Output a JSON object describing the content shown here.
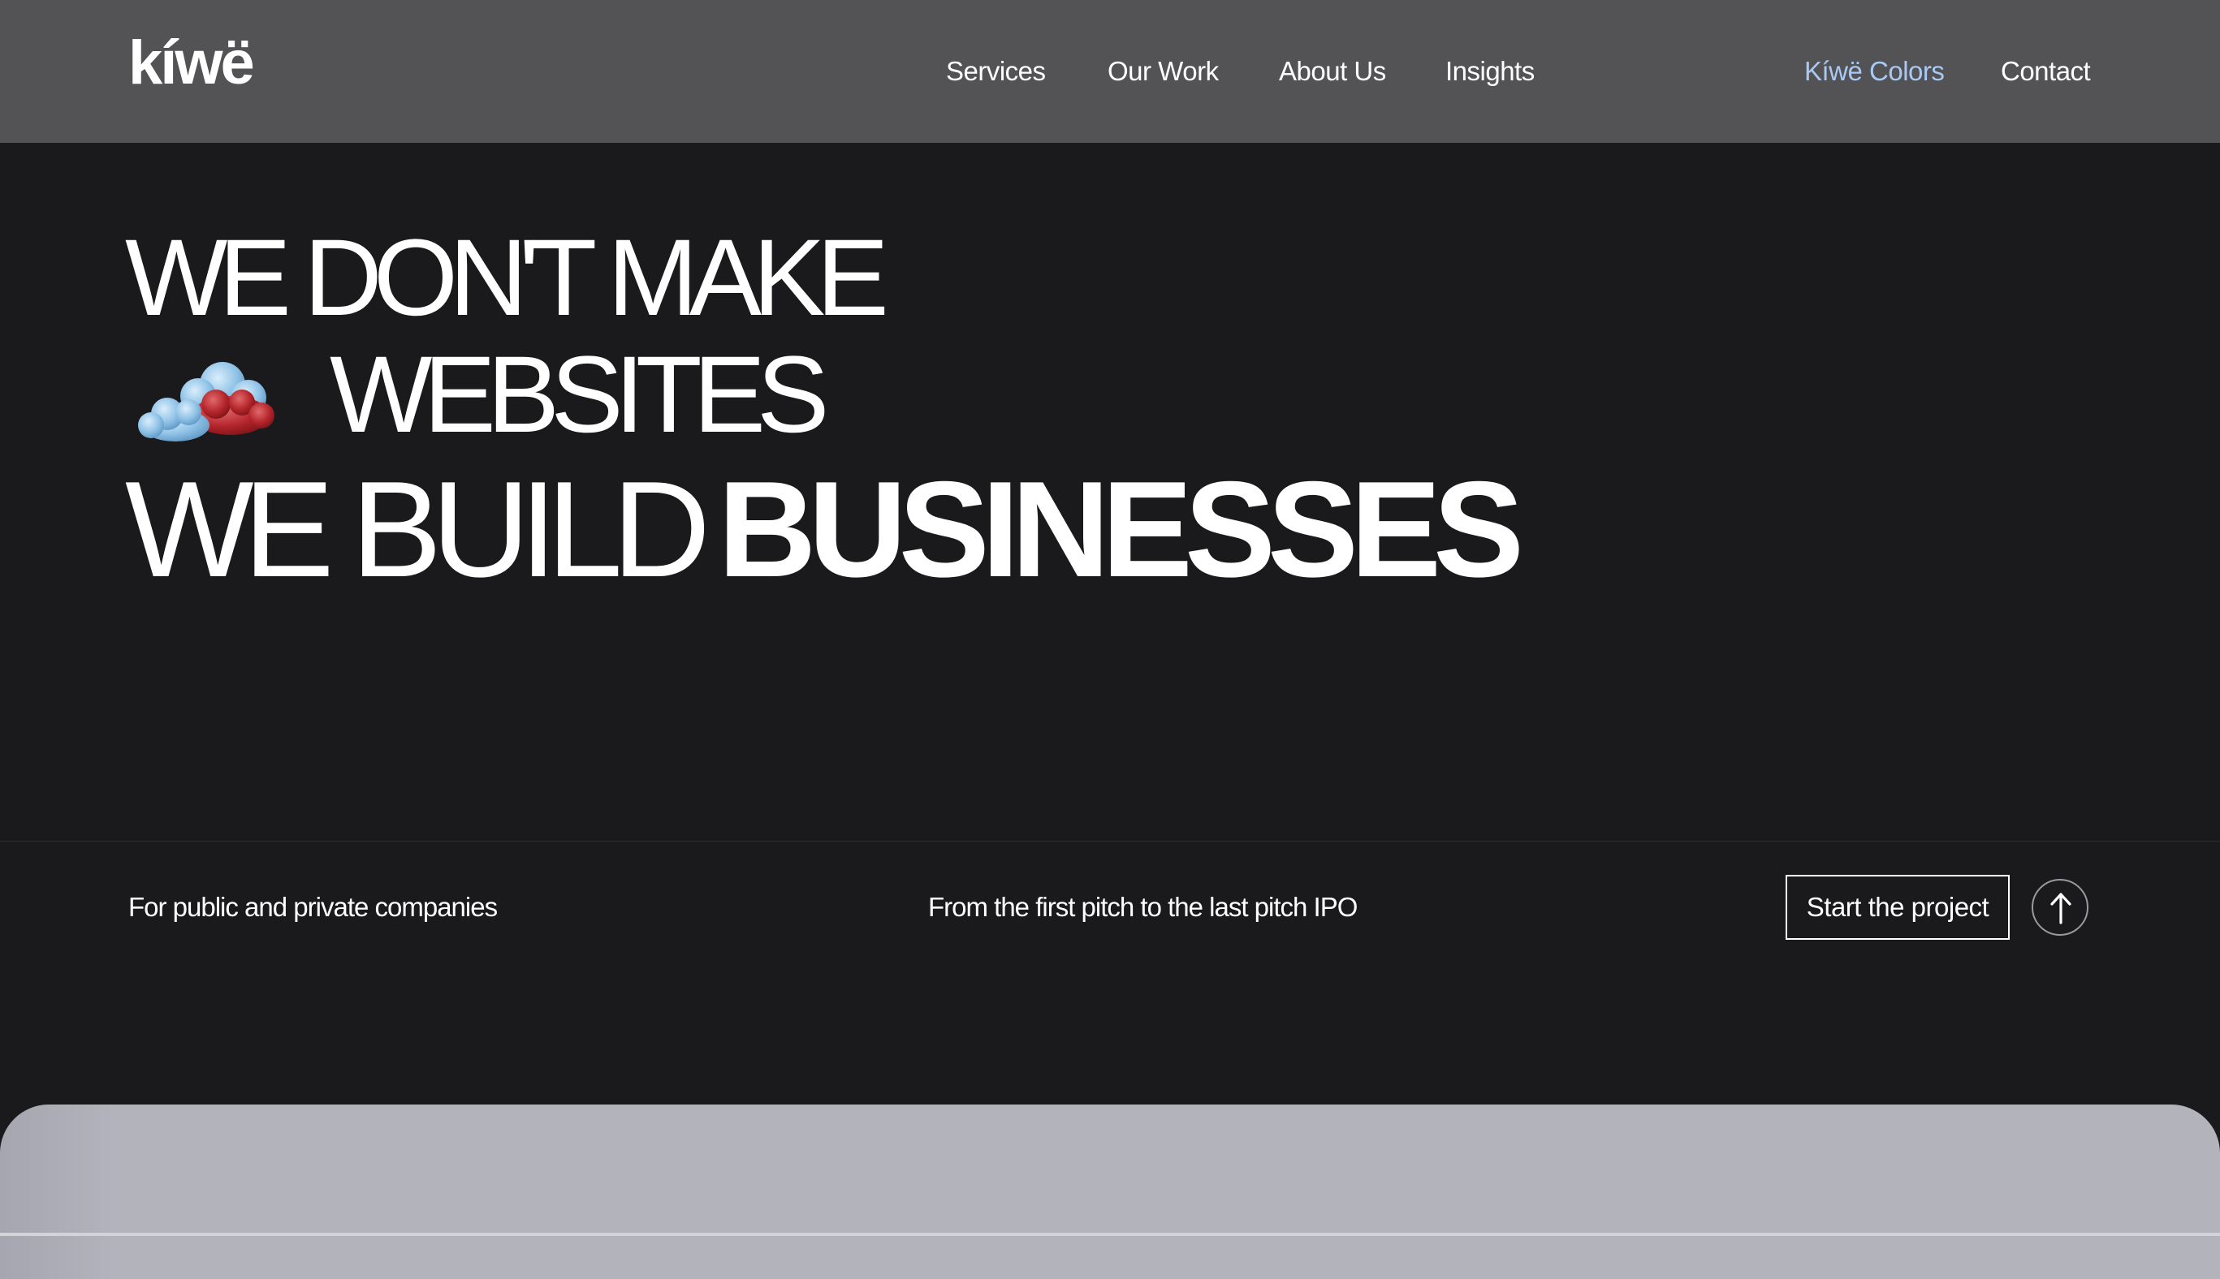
{
  "header": {
    "logo": "kíwë",
    "nav": {
      "services": "Services",
      "our_work": "Our Work",
      "about_us": "About Us",
      "insights": "Insights",
      "kiwe_colors": "Kíwë Colors",
      "contact": "Contact"
    },
    "accent_color": "#a9c8f2"
  },
  "hero": {
    "line1": "WE DON'T MAKE",
    "line2": "WEBSITES",
    "line3_light": "WE BUILD",
    "line3_bold": "BUSINESSES",
    "emoji_icon": "cloud-icon"
  },
  "tagline": {
    "left": "For public and private companies",
    "middle": "From the first pitch to the last pitch IPO"
  },
  "cta": {
    "button_label": "Start the project",
    "circle_icon": "arrow-up-icon"
  }
}
